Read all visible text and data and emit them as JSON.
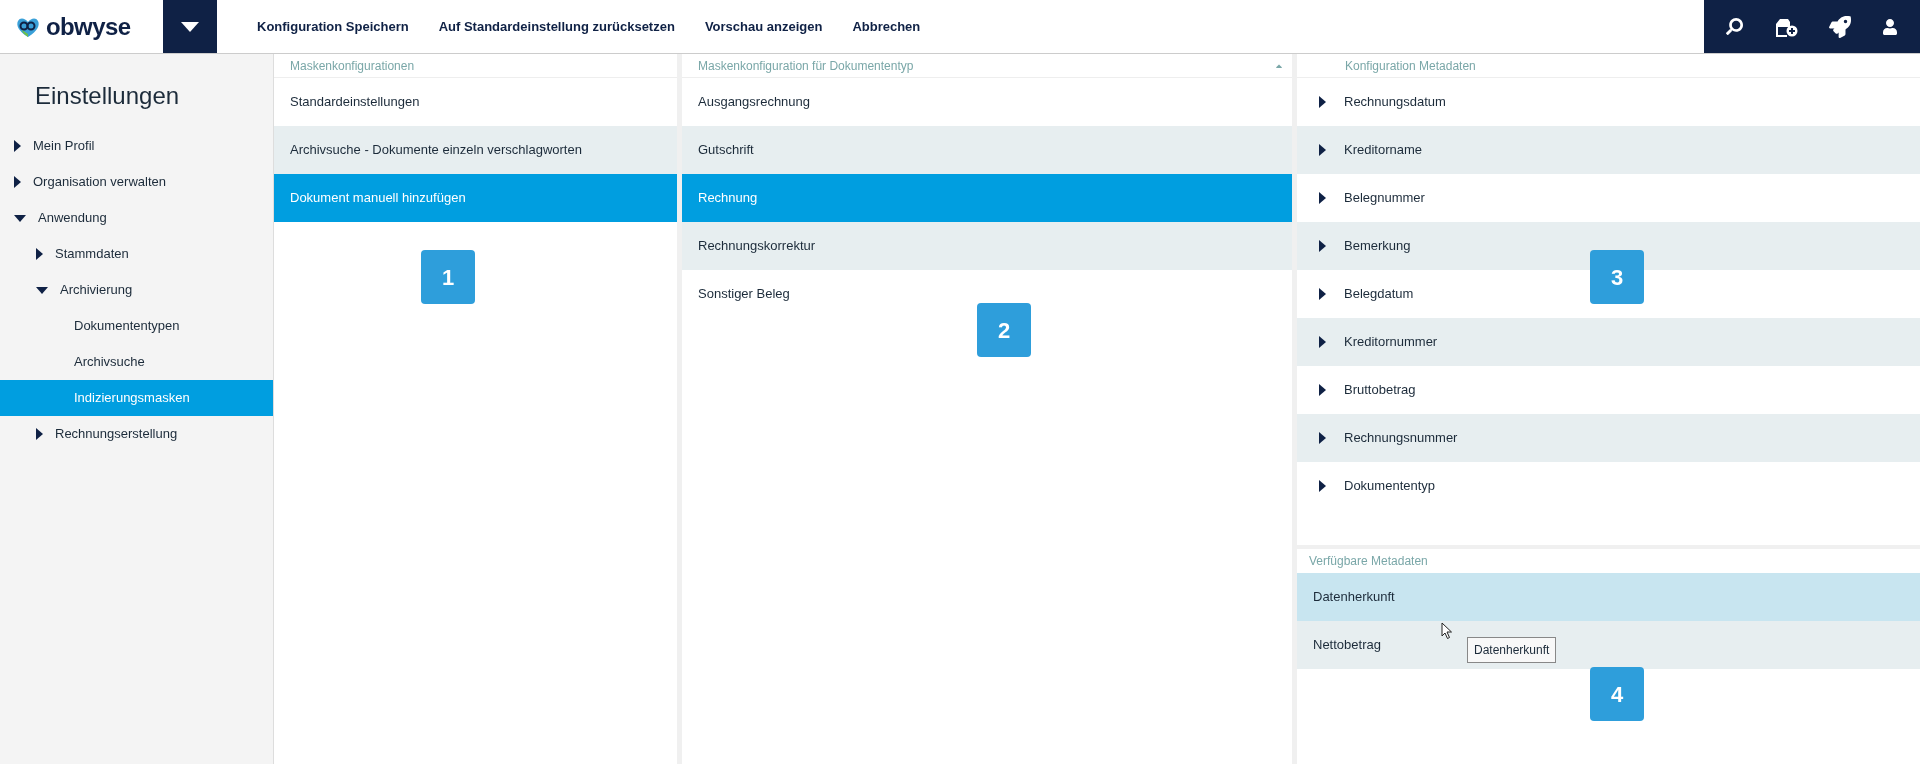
{
  "header": {
    "logo": "obwyse",
    "actions": [
      "Konfiguration Speichern",
      "Auf Standardeinstellung zurücksetzen",
      "Vorschau anzeigen",
      "Abbrechen"
    ]
  },
  "sidebar": {
    "title": "Einstellungen",
    "items": [
      {
        "label": "Mein Profil",
        "expanded": false,
        "selected": false
      },
      {
        "label": "Organisation verwalten",
        "expanded": false,
        "selected": false
      },
      {
        "label": "Anwendung",
        "expanded": true,
        "selected": false,
        "children": [
          {
            "label": "Stammdaten",
            "expanded": false,
            "selected": false
          },
          {
            "label": "Archivierung",
            "expanded": true,
            "selected": false,
            "children": [
              {
                "label": "Dokumententypen",
                "selected": false
              },
              {
                "label": "Archivsuche",
                "selected": false
              },
              {
                "label": "Indizierungsmasken",
                "selected": true
              }
            ]
          },
          {
            "label": "Rechnungserstellung",
            "expanded": false,
            "selected": false
          }
        ]
      }
    ]
  },
  "mask_configurations": {
    "heading": "Maskenkonfigurationen",
    "badge": "1",
    "items": [
      {
        "label": "Standardeinstellungen",
        "selected": false
      },
      {
        "label": "Archivsuche - Dokumente einzeln verschlagworten",
        "selected": false
      },
      {
        "label": "Dokument manuell hinzufügen",
        "selected": true
      }
    ]
  },
  "document_types": {
    "heading": "Maskenkonfiguration für Dokumententyp",
    "badge": "2",
    "items": [
      {
        "label": "Ausgangsrechnung",
        "selected": false
      },
      {
        "label": "Gutschrift",
        "selected": false
      },
      {
        "label": "Rechnung",
        "selected": true
      },
      {
        "label": "Rechnungskorrektur",
        "selected": false
      },
      {
        "label": "Sonstiger Beleg",
        "selected": false
      }
    ]
  },
  "metadata_configuration": {
    "heading": "Konfiguration Metadaten",
    "badge": "3",
    "items": [
      {
        "label": "Rechnungsdatum",
        "expanded": false
      },
      {
        "label": "Kreditorname",
        "expanded": false
      },
      {
        "label": "Belegnummer",
        "expanded": false
      },
      {
        "label": "Bemerkung",
        "expanded": false
      },
      {
        "label": "Belegdatum",
        "expanded": false
      },
      {
        "label": "Kreditornummer",
        "expanded": false
      },
      {
        "label": "Bruttobetrag",
        "expanded": false
      },
      {
        "label": "Rechnungsnummer",
        "expanded": false
      },
      {
        "label": "Dokumententyp",
        "expanded": false
      }
    ]
  },
  "available_metadata": {
    "heading": "Verfügbare Metadaten",
    "badge": "4",
    "items": [
      {
        "label": "Datenherkunft",
        "hovered": true
      },
      {
        "label": "Nettobetrag",
        "hovered": false
      }
    ],
    "tooltip": "Datenherkunft"
  }
}
